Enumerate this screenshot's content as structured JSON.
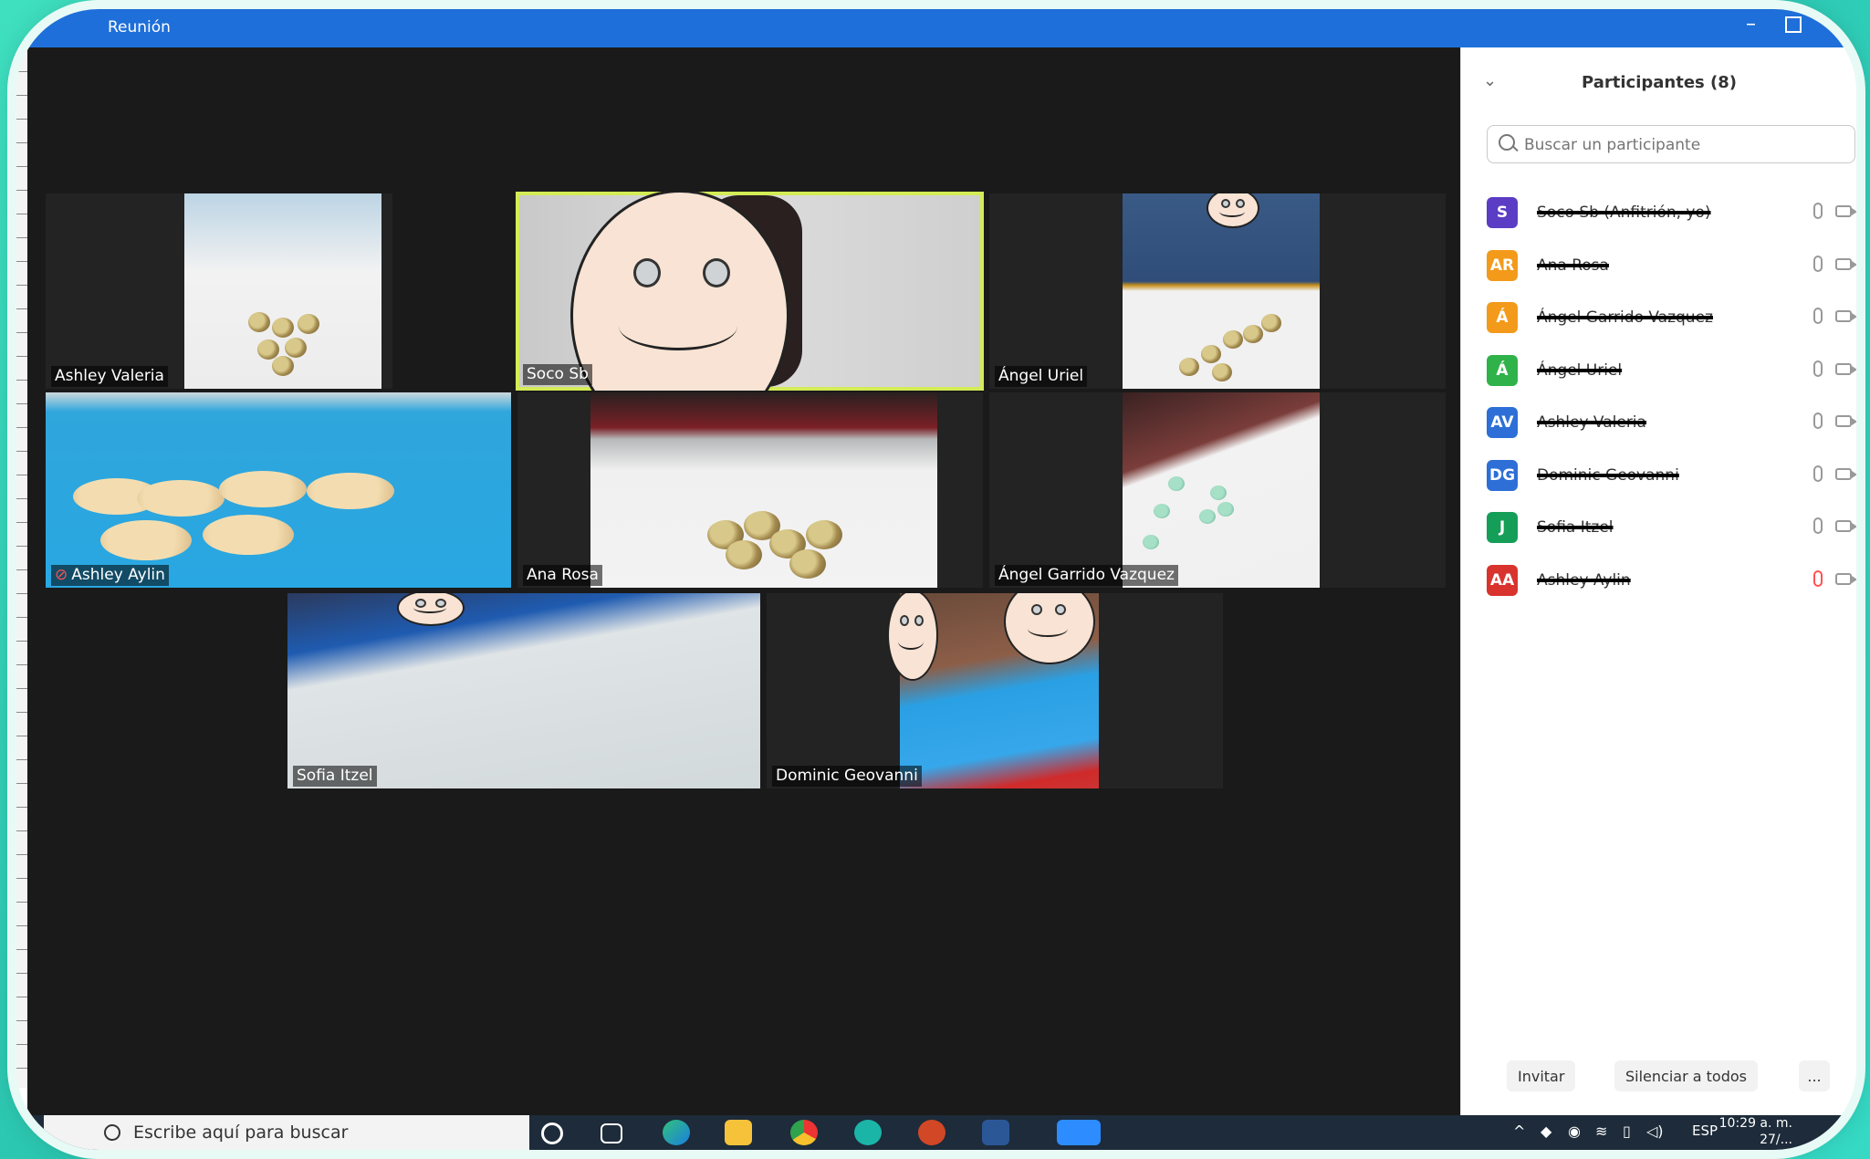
{
  "window": {
    "title": "Reunión"
  },
  "tiles": [
    {
      "name": "Ashley Valeria",
      "muted": false
    },
    {
      "name": "Soco Sb",
      "muted": false
    },
    {
      "name": "Ángel Uriel",
      "muted": false
    },
    {
      "name": "Ashley Aylin",
      "muted": true
    },
    {
      "name": "Ana Rosa",
      "muted": false
    },
    {
      "name": "Ángel Garrido Vazquez",
      "muted": false
    },
    {
      "name": "Sofia Itzel",
      "muted": false
    },
    {
      "name": "Dominic Geovanni",
      "muted": false
    }
  ],
  "sidebar": {
    "title": "Participantes (8)",
    "search_placeholder": "Buscar un participante",
    "participants": [
      {
        "initials": "S",
        "name": "Soco Sb (Anfitrión, yo)",
        "color": "#5b3cc4",
        "mic_muted": false
      },
      {
        "initials": "AR",
        "name": "Ana Rosa",
        "color": "#f39a1b",
        "mic_muted": false
      },
      {
        "initials": "Á",
        "name": "Ángel Garrido Vazquez",
        "color": "#f39a1b",
        "mic_muted": false
      },
      {
        "initials": "Á",
        "name": "Ángel Uriel",
        "color": "#2fb24a",
        "mic_muted": false
      },
      {
        "initials": "AV",
        "name": "Ashley Valeria",
        "color": "#2d6fd6",
        "mic_muted": false
      },
      {
        "initials": "DG",
        "name": "Dominic Geovanni",
        "color": "#2d6fd6",
        "mic_muted": false
      },
      {
        "initials": "J",
        "name": "Sofia Itzel",
        "color": "#159e58",
        "mic_muted": false
      },
      {
        "initials": "AA",
        "name": "Ashley Aylin",
        "color": "#d9332e",
        "mic_muted": true
      }
    ],
    "invite_label": "Invitar",
    "mute_all_label": "Silenciar a todos",
    "more_label": "..."
  },
  "taskbar": {
    "search_text": "Escribe aquí para buscar",
    "lang": "ESP",
    "time": "10:29 a. m.",
    "date": "27/..."
  }
}
